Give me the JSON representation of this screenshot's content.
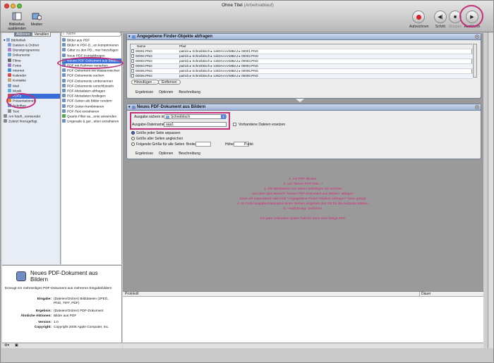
{
  "window": {
    "title": "Ohne Titel",
    "subtitle": "(Arbeitsablauf)"
  },
  "toolbar": {
    "left": [
      {
        "label": "Bibliothek ausblenden"
      },
      {
        "label": "Medien"
      }
    ],
    "right": [
      {
        "label": "Aufzeichnen"
      },
      {
        "label": "Schritt"
      },
      {
        "label": "Stoppen"
      },
      {
        "label": "Ausführen"
      }
    ]
  },
  "library": {
    "tabs": [
      "Aktionen",
      "Variablen"
    ],
    "search_placeholder": "Name",
    "root": "Bibliothek",
    "categories": [
      "Dateien & Ordner",
      "Dienstprogramme",
      "Dokumente",
      "Filme",
      "Fotos",
      "Internet",
      "Kalender",
      "Kontakte",
      "Mail",
      "Musik",
      "PDFs",
      "Präsentationen",
      "Schriften",
      "Text"
    ],
    "smart": [
      "Am häufi...verwendet",
      "Zuletzt hinzugefügt"
    ],
    "actions": [
      "Bilder aus PDF",
      "Bilder in PDF-D...en komprimieren",
      "Gitter zu den PD...mer hinzufügen",
      "Neue PDF-Kontaktbogen",
      "Neues PDF-Dokument aus Bildern",
      "PDF mit Rahmen versehen",
      "PDF-Dokument mit Wasserzeichen",
      "PDF-Dokumente suchen",
      "PDF-Dokumente umbenennen",
      "PDF-Dokumente verschlüsseln",
      "PDF-Metadaten abfragen",
      "PDF-Metadaten festlegen",
      "PDF-Seiten als Bilder rendern",
      "PDF-Seiten kombinieren",
      "PDF-Text extrahieren",
      "Quartz-Filter au...ente anwenden",
      "Ungerade & ger...eiten extrahieren"
    ]
  },
  "description": {
    "title": "Neues PDF-Dokument aus Bildern",
    "summary": "Erzeugt ein mehrseitiges PDF-Dokument aus mehreren Eingabebildern",
    "rows": [
      {
        "k": "Eingabe:",
        "v": "(Dateien/Ordner) Bilddateien (JPEG, PNG, TIFF, PDF)"
      },
      {
        "k": "Ergebnis:",
        "v": "(Dateien/Ordner) PDF-Dokument"
      },
      {
        "k": "Ähnliche Aktionen:",
        "v": "Bilder aus PDF"
      },
      {
        "k": "Version:",
        "v": "1.0"
      },
      {
        "k": "Copyright:",
        "v": "Copyright 2006 Apple Computer, Inc."
      }
    ]
  },
  "action1": {
    "title": "Angegebene Finder-Objekte abfragen",
    "col_name": "Name",
    "col_path": "Pfad",
    "rows": [
      {
        "name": "00001.PNG",
        "path": "patrick ▸ Schreibtisch ▸ 1vkDAAAAMBAJ ▸ 00001.PNG"
      },
      {
        "name": "00002.PNG",
        "path": "patrick ▸ Schreibtisch ▸ 1vkDAAAAMBAJ ▸ 00002.PNG"
      },
      {
        "name": "00003.PNG",
        "path": "patrick ▸ Schreibtisch ▸ 1vkDAAAAMBAJ ▸ 00003.PNG"
      },
      {
        "name": "00004.PNG",
        "path": "patrick ▸ Schreibtisch ▸ 1vkDAAAAMBAJ ▸ 00004.PNG"
      },
      {
        "name": "00005.PNG",
        "path": "patrick ▸ Schreibtisch ▸ 1vkDAAAAMBAJ ▸ 00005.PNG"
      },
      {
        "name": "00006.PNG",
        "path": "patrick ▸ Schreibtisch ▸ 1vkDAAAAMBAJ ▸ 00006.PNG"
      }
    ],
    "add_btn": "Hinzufügen ...",
    "remove_btn": "Entfernen",
    "tabs": [
      "Ergebnisse",
      "Optionen",
      "Beschreibung"
    ]
  },
  "action2": {
    "title": "Neues PDF-Dokument aus Bildern",
    "save_label": "Ausgabe sichern in:",
    "save_value": "Schreibtisch",
    "name_label": "Ausgabe-Dateiname:",
    "name_value": "aaa1",
    "replace_label": "Vorhandene Dateien ersetzen",
    "radio1": "Größe jeder Seite anpassen",
    "radio2": "Größe aller Seiten angleichen",
    "radio3": "Folgende Größe für alle Seiten",
    "width_label": "Breite:",
    "height_label": "Höhe:",
    "unit": "Punkt",
    "tabs": [
      "Ergebnisse",
      "Optionen",
      "Beschreibung"
    ]
  },
  "annotation": [
    "1. Auf PDF klicken.",
    "2. auf \"Neues PDF-Dok...\"",
    "3. Die Bilddateien von einem beliebigen Ort nehmen",
    "und über dem Bereich \"Neues PDF-Dokument aus Bildern\" ablegen.",
    "Dann wir automatisch das Feld \"Angegebene Finder-Objekte abfragen\" hinzu gefügt.",
    "4. Im Feld Ausgabe-Dateiname einen Namen eingeben den Ort für die Ausgabe wählen.",
    "5. \"Ausführung\" anklicken.",
    "",
    "Ein paar Sekunden später habt ihr dann eine fertige PDF."
  ],
  "log": {
    "col1": "Protokoll",
    "col2": "Dauer"
  },
  "colors": {
    "annotation": "#d6287a",
    "selection": "#3a6cd8",
    "ring": "#c1307a"
  }
}
